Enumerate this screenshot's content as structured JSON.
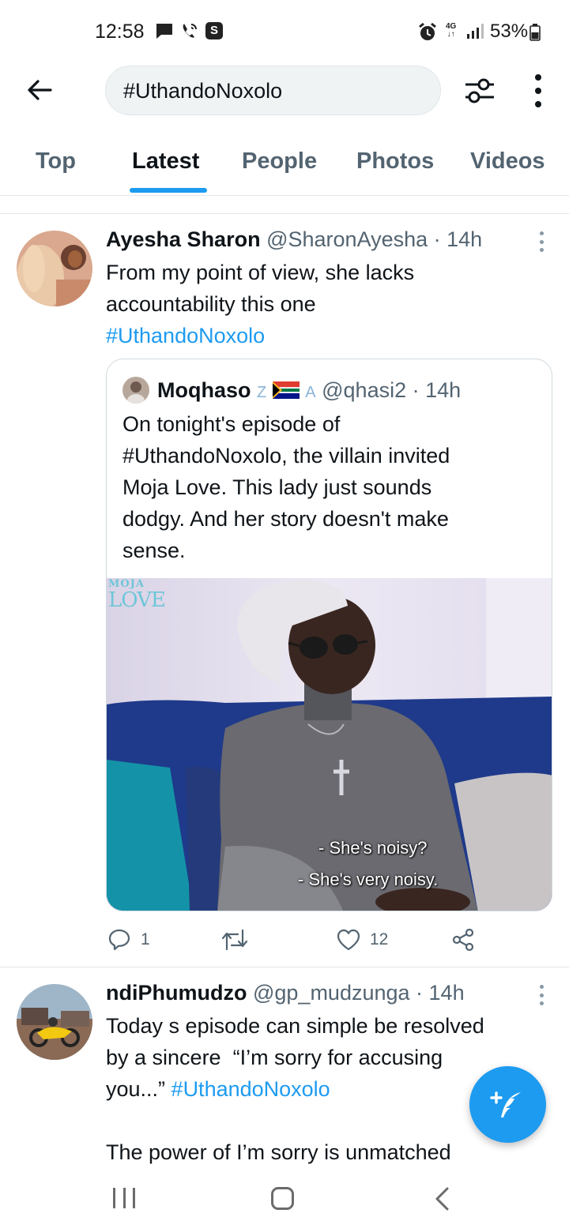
{
  "status_bar": {
    "time": "12:58",
    "battery": "53%",
    "network": "4G",
    "icons": [
      "message-icon",
      "wifi-call-icon",
      "s-app-icon",
      "alarm-icon",
      "4g-icon",
      "signal-icon",
      "battery-icon"
    ]
  },
  "search": {
    "query": "#UthandoNoxolo"
  },
  "tabs": [
    {
      "label": "Top",
      "active": false
    },
    {
      "label": "Latest",
      "active": true
    },
    {
      "label": "People",
      "active": false
    },
    {
      "label": "Photos",
      "active": false
    },
    {
      "label": "Videos",
      "active": false
    }
  ],
  "tweets": [
    {
      "name": "Ayesha Sharon",
      "handle": "@SharonAyesha",
      "time": "· 14h",
      "text_1": "From my point of view, she lacks",
      "text_2": "accountability this one",
      "hashtag": "#UthandoNoxolo",
      "quote": {
        "name": "Moqhaso",
        "badges": "Z",
        "badge_2": "A",
        "handle": "@qhasi2",
        "time": "· 14h",
        "lines": [
          "On tonight's episode of",
          "#UthandoNoxolo, the villain invited",
          "Moja Love. This lady just sounds",
          "dodgy. And her story doesn't make",
          "sense."
        ],
        "media": {
          "brand_top": "MOJA",
          "brand_bottom": "LOVE",
          "subtitle_1": "- She's noisy?",
          "subtitle_2": "- She's very noisy."
        }
      },
      "actions": {
        "replies": "1",
        "retweets": "",
        "likes": "12"
      }
    },
    {
      "name": "ndiPhumudzo",
      "handle": "@gp_mudzunga",
      "time": "· 14h",
      "text_1": "Today s episode can simple be resolved",
      "text_2": "by a sincere  “I’m sorry for accusing",
      "text_3": "you...”",
      "hashtag": "#UthandoNoxolo",
      "text_4": "The power of I’m sorry is unmatched"
    }
  ],
  "colors": {
    "accent": "#1d9bf0",
    "text": "#0f1419",
    "muted": "#536471",
    "search_bg": "#eff3f4"
  }
}
